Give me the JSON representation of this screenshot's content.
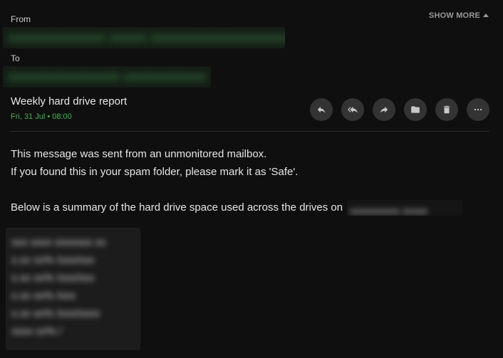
{
  "header": {
    "from_label": "From",
    "to_label": "To",
    "show_more_label": "SHOW MORE",
    "from_value": "",
    "to_value": ""
  },
  "message": {
    "subject": "Weekly hard drive report",
    "date": "Fri, 31 Jul • 08:00"
  },
  "actions": [
    {
      "name": "reply",
      "icon": "reply-icon"
    },
    {
      "name": "reply-all",
      "icon": "reply-all-icon"
    },
    {
      "name": "forward",
      "icon": "forward-icon"
    },
    {
      "name": "move-to-folder",
      "icon": "folder-icon"
    },
    {
      "name": "delete",
      "icon": "trash-icon"
    },
    {
      "name": "more",
      "icon": "more-horizontal-icon"
    }
  ],
  "body": {
    "line1": "This message was sent from an unmonitored mailbox.",
    "line2": "If you found this in your spam folder, please mark it as 'Safe'.",
    "line3": "Below is a summary of the hard drive space used across the drives on",
    "hostname": ""
  },
  "colors": {
    "background": "#0f0f0f",
    "accent_green": "#4caf50",
    "button_bg": "#333333"
  }
}
